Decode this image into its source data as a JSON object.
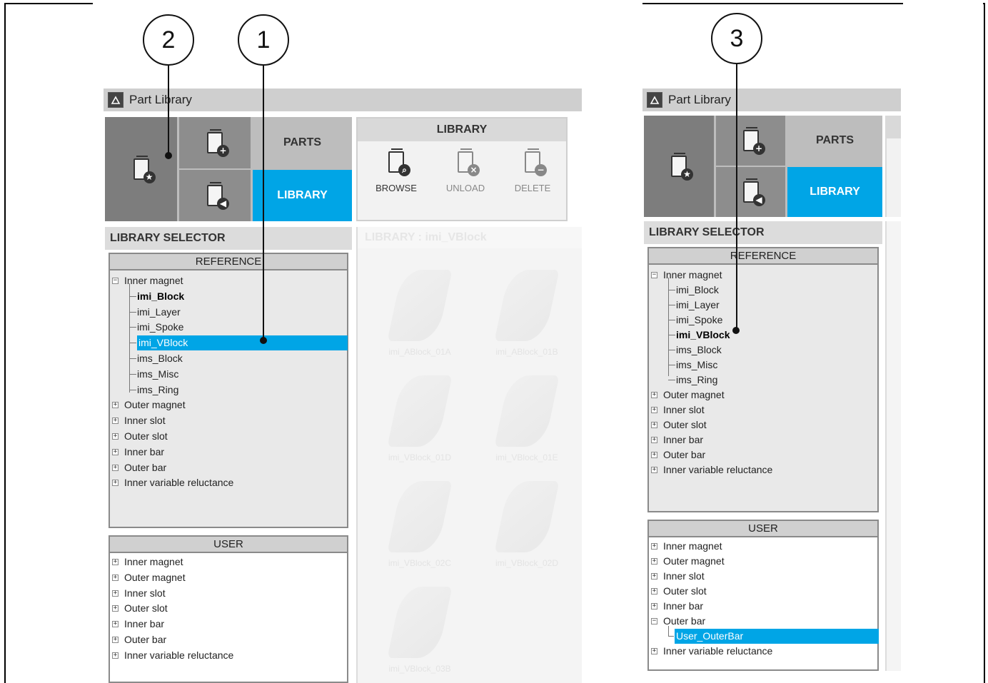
{
  "callouts": [
    "2",
    "1",
    "3"
  ],
  "left_window": {
    "title": "Part Library",
    "tiles": {
      "parts_label": "PARTS",
      "library_label": "LIBRARY"
    },
    "library_group": {
      "title": "LIBRARY",
      "browse": "BROWSE",
      "unload": "UNLOAD",
      "delete": "DELETE"
    },
    "selector_title": "LIBRARY SELECTOR",
    "reference": {
      "header": "REFERENCE",
      "root": "Inner magnet",
      "children": [
        "imi_Block",
        "imi_Layer",
        "imi_Spoke",
        "imi_VBlock",
        "ims_Block",
        "ims_Misc",
        "ims_Ring"
      ],
      "others": [
        "Outer magnet",
        "Inner slot",
        "Outer slot",
        "Inner bar",
        "Outer bar",
        "Inner variable reluctance"
      ]
    },
    "user": {
      "header": "USER",
      "items": [
        "Inner magnet",
        "Outer magnet",
        "Inner slot",
        "Outer slot",
        "Inner bar",
        "Outer bar",
        "Inner variable reluctance"
      ]
    },
    "library_pane": {
      "header": "LIBRARY : imi_VBlock",
      "thumbs": [
        "imi_ABlock_01A",
        "imi_ABlock_01B",
        "imi_VBlock_01D",
        "imi_VBlock_01E",
        "imi_VBlock_02C",
        "imi_VBlock_02D",
        "imi_VBlock_03B"
      ]
    }
  },
  "right_window": {
    "title": "Part Library",
    "tiles": {
      "parts_label": "PARTS",
      "library_label": "LIBRARY"
    },
    "selector_title": "LIBRARY SELECTOR",
    "reference": {
      "header": "REFERENCE",
      "root": "Inner magnet",
      "children": [
        "imi_Block",
        "imi_Layer",
        "imi_Spoke",
        "imi_VBlock",
        "ims_Block",
        "ims_Misc",
        "ims_Ring"
      ],
      "others": [
        "Outer magnet",
        "Inner slot",
        "Outer slot",
        "Inner bar",
        "Outer bar",
        "Inner variable reluctance"
      ]
    },
    "user": {
      "header": "USER",
      "items": [
        "Inner magnet",
        "Outer magnet",
        "Inner slot",
        "Outer slot",
        "Inner bar",
        "Outer bar"
      ],
      "child": "User_OuterBar",
      "last": "Inner variable reluctance"
    }
  },
  "icons": {
    "star": "library-star-icon",
    "add": "library-add-icon",
    "import": "library-import-icon",
    "browse": "library-browse-icon",
    "unload": "library-unload-icon",
    "delete": "library-delete-icon"
  },
  "colors": {
    "accent": "#00a5e6",
    "tile_dark": "#7d7d7d",
    "tile_light": "#bdbdbd"
  }
}
